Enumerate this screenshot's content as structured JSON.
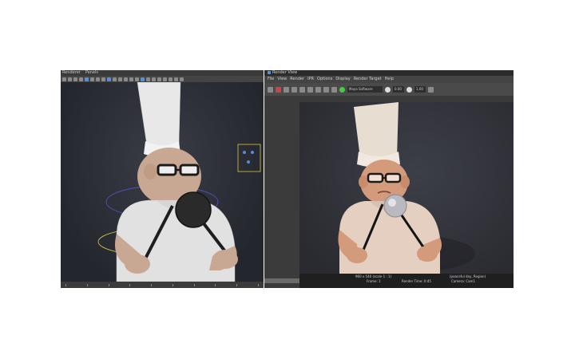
{
  "left_viewport": {
    "menu": [
      "Renderer",
      "Panels"
    ]
  },
  "render_view": {
    "title": "Render View",
    "menu": [
      "File",
      "View",
      "Render",
      "IPR",
      "Options",
      "Display",
      "Render Target",
      "Help"
    ],
    "renderer_select": "Maya Software",
    "exposure_value": "0.00",
    "gamma_value": "1.00",
    "status": {
      "size": "960 x 540 (scale 1 : 1)",
      "region": "(peaceful day, Region)",
      "frame": "Frame: 1",
      "render_time": "Render Time: 0:45",
      "camera": "Camera: Cam1"
    }
  }
}
